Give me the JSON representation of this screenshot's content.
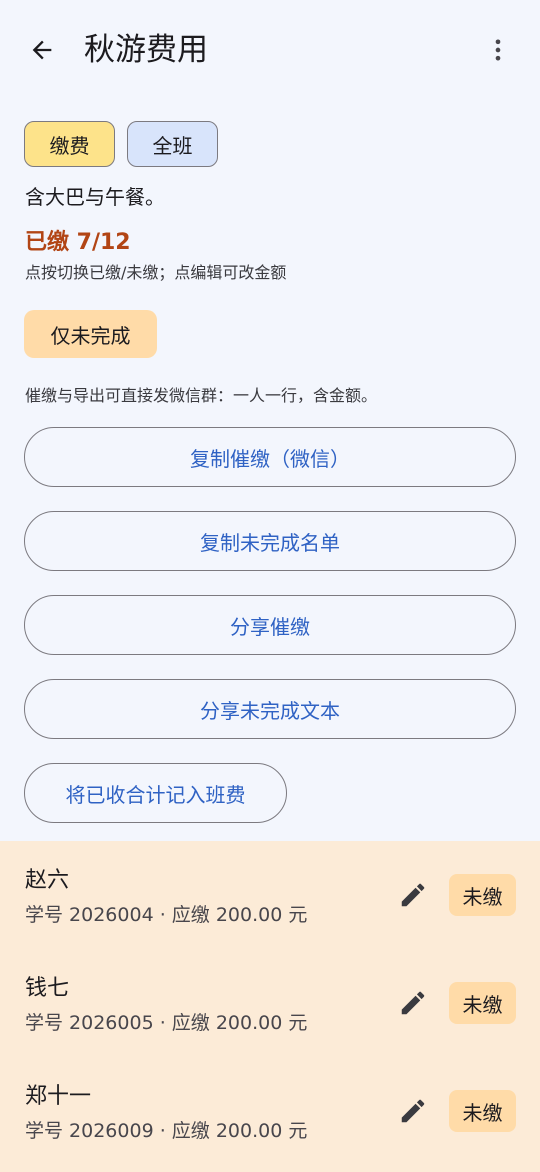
{
  "appbar": {
    "title": "秋游费用",
    "back_icon": "arrow-back-icon",
    "more_icon": "more-vert-icon"
  },
  "tags": {
    "fee": "缴费",
    "scope": "全班"
  },
  "description": "含大巴与午餐。",
  "paid_status": "已缴 7/12",
  "hint": "点按切换已缴/未缴；点编辑可改金额",
  "filter_chip": "仅未完成",
  "tip": "催缴与导出可直接发微信群：一人一行，含金额。",
  "actions": {
    "copy_reminder": "复制催缴（微信）",
    "copy_unfinished": "复制未完成名单",
    "share_reminder": "分享催缴",
    "share_unfinished_text": "分享未完成文本",
    "record_to_class_fee": "将已收合计记入班费"
  },
  "students": [
    {
      "name": "赵六",
      "meta": "学号 2026004 · 应缴 200.00 元",
      "status": "未缴"
    },
    {
      "name": "钱七",
      "meta": "学号 2026005 · 应缴 200.00 元",
      "status": "未缴"
    },
    {
      "name": "郑十一",
      "meta": "学号 2026009 · 应缴 200.00 元",
      "status": "未缴"
    }
  ],
  "colors": {
    "background": "#f3f6fd",
    "accent_blue": "#2f62c4",
    "paid_status": "#b24515",
    "list_background": "#fcebd7",
    "chip_orange": "#ffdba8",
    "tag_yellow": "#fde38a",
    "tag_blue": "#d8e4fb"
  }
}
